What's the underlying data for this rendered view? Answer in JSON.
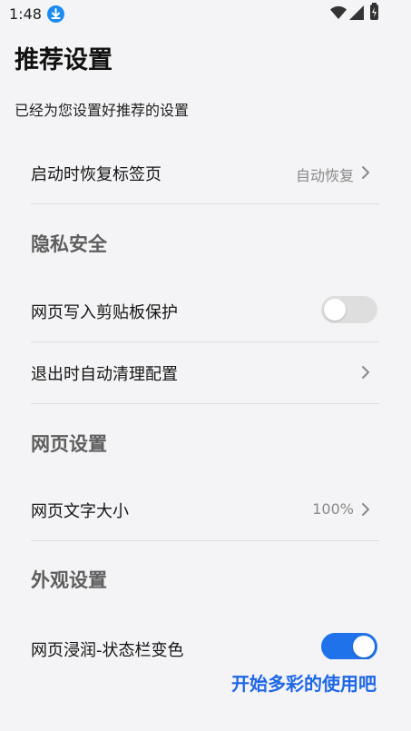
{
  "status_bar": {
    "time": "1:48",
    "icons": [
      "download-icon",
      "wifi-icon",
      "signal-icon",
      "battery-icon"
    ]
  },
  "header": {
    "title": "推荐设置",
    "subtitle": "已经为您设置好推荐的设置"
  },
  "items": {
    "restore_tabs": {
      "label": "启动时恢复标签页",
      "value": "自动恢复"
    },
    "privacy_section": "隐私安全",
    "clipboard_protection": {
      "label": "网页写入剪贴板保护",
      "enabled": false
    },
    "auto_clear": {
      "label": "退出时自动清理配置"
    },
    "web_section": "网页设置",
    "font_size": {
      "label": "网页文字大小",
      "value": "100%"
    },
    "appearance_section": "外观设置",
    "immersive_status_bar": {
      "label": "网页浸润-状态栏变色",
      "enabled": true
    }
  },
  "footer": {
    "start_label": "开始多彩的使用吧"
  },
  "colors": {
    "accent": "#1f72ea",
    "link": "#1d67e6",
    "background": "#f4f3f5"
  }
}
